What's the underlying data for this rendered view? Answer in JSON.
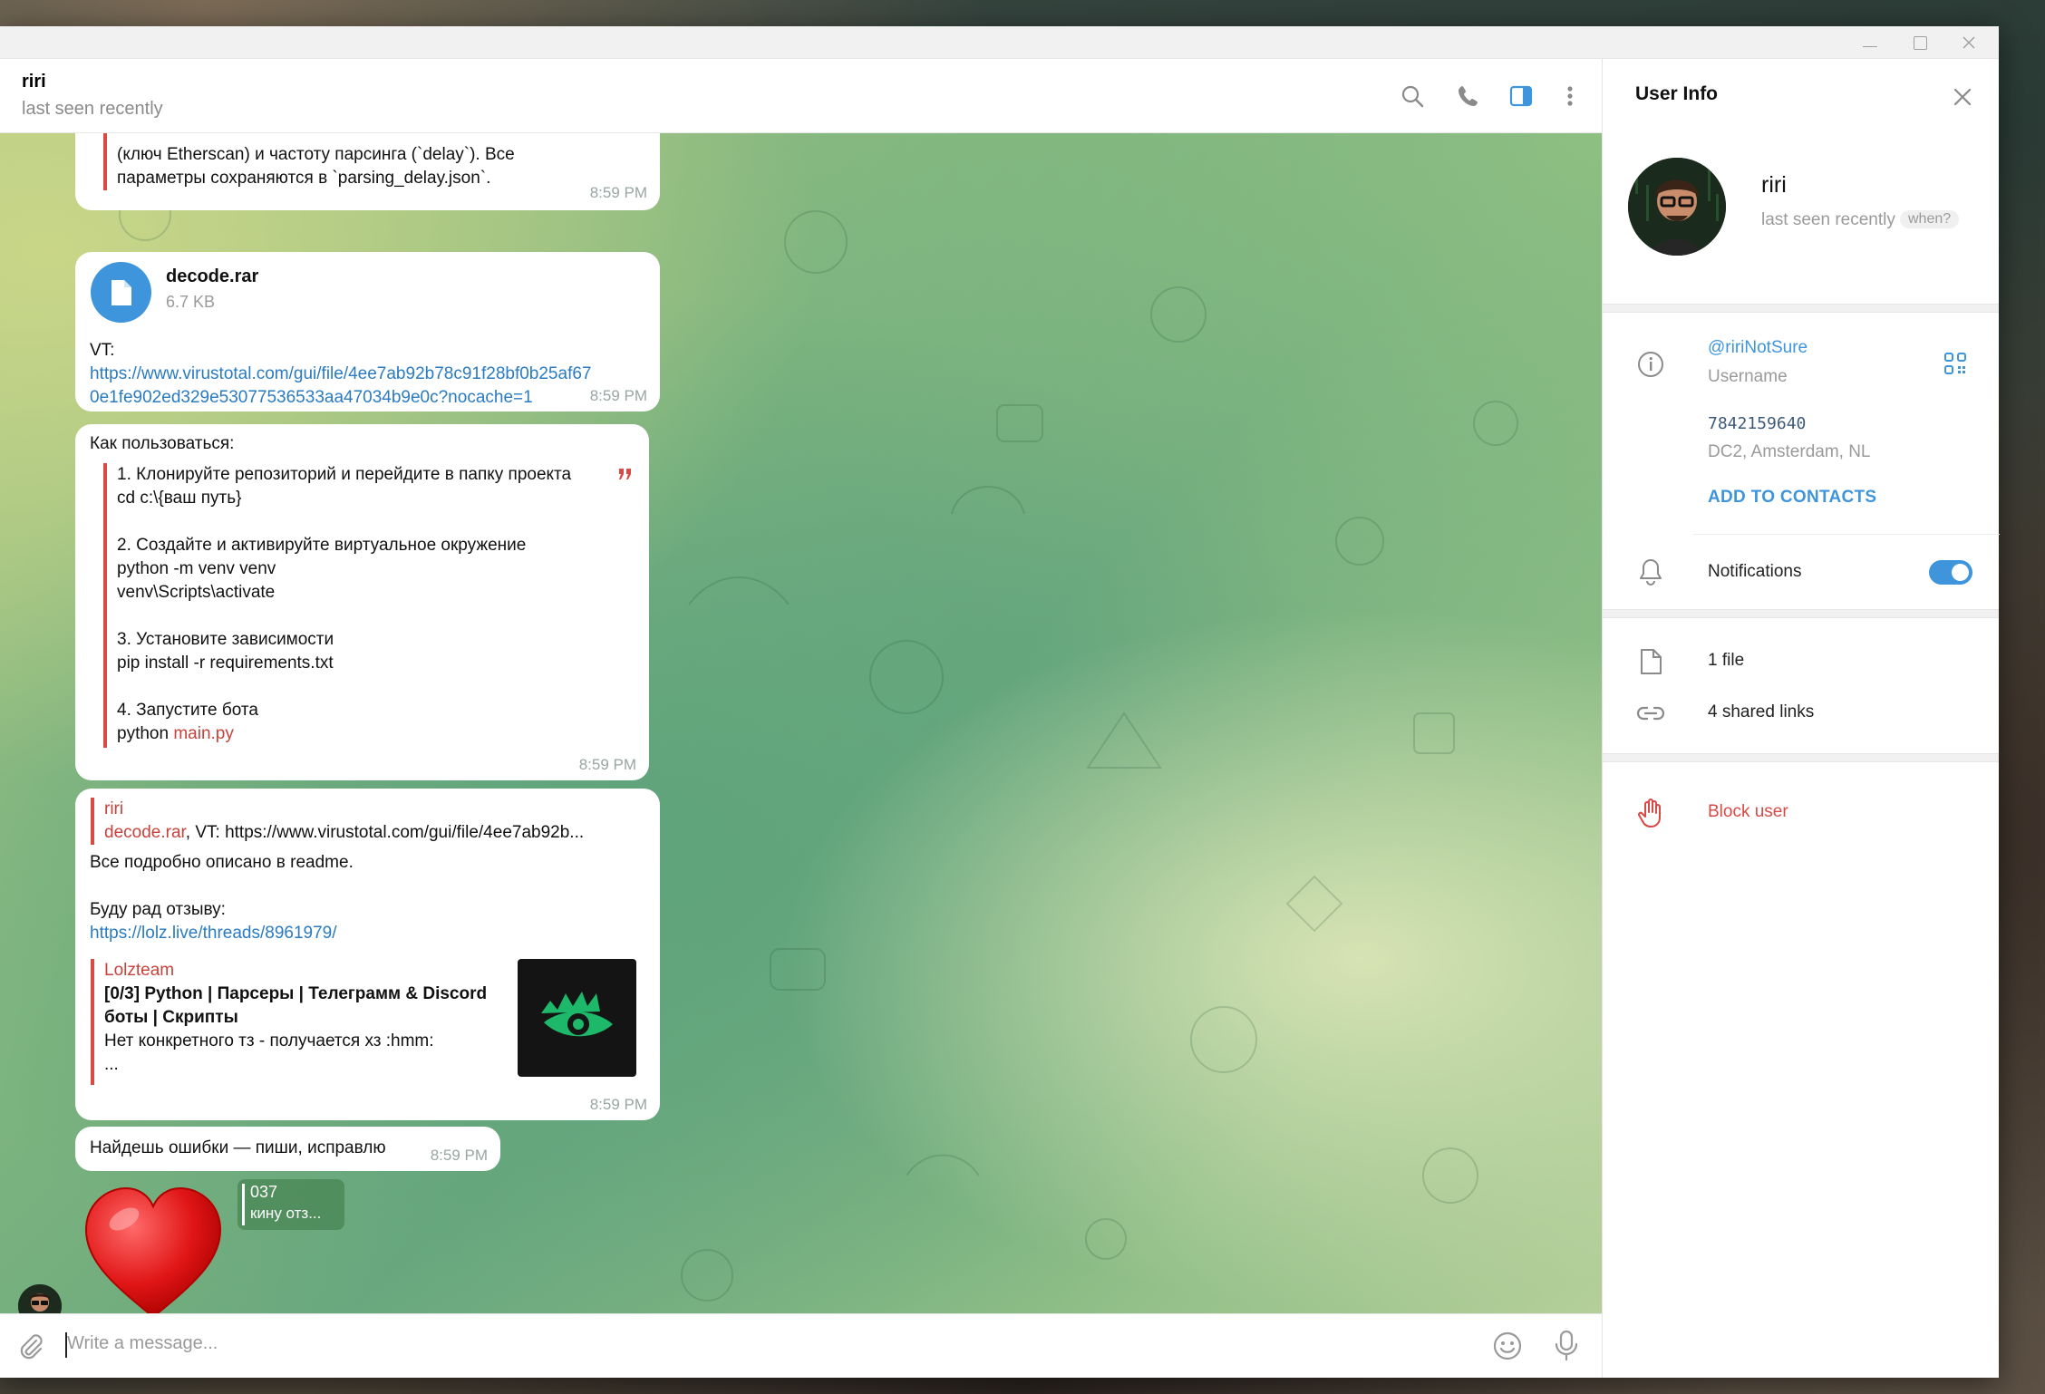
{
  "header": {
    "title": "riri",
    "status": "last seen recently"
  },
  "messages": {
    "m1": {
      "line1": "(ключ Etherscan) и частоту парсинга (`delay`). Все",
      "line2": "параметры сохраняются в `parsing_delay.json`.",
      "time": "8:59 PM"
    },
    "m2": {
      "file_name": "decode.rar",
      "file_size": "6.7 KB",
      "text": "VT:",
      "link1": "https://www.virustotal.com/gui/file/4ee7ab92b78c91f28bf0b25af67",
      "link2": "0e1fe902ed329e53077536533aa47034b9e0c?nocache=1",
      "time": "8:59 PM"
    },
    "m3": {
      "intro": "Как пользоваться:",
      "lines": [
        "1. Клонируйте репозиторий и перейдите в папку проекта",
        "cd c:\\{ваш путь}",
        "",
        "2. Создайте и активируйте виртуальное окружение",
        "python -m venv venv",
        "venv\\Scripts\\activate",
        "",
        "3. Установите зависимости",
        "pip install -r requirements.txt",
        "",
        "4. Запустите бота"
      ],
      "last_prefix": "python ",
      "last_link": "main.py",
      "time": "8:59 PM"
    },
    "m4": {
      "reply_author": "riri",
      "reply_link": "decode.rar",
      "reply_rest": ", VT:  https://www.virustotal.com/gui/file/4ee7ab92b...",
      "text1": "Все подробно описано в readme.",
      "text2": "Буду рад отзыву:",
      "link": "https://lolz.live/threads/8961979/",
      "preview_site": "Lolzteam",
      "preview_title1": "[0/3] Python | Парсеры | Телеграмм & Discord",
      "preview_title2": "боты | Скрипты",
      "preview_desc": "Нет конкретного тз - получается  хз :hmm:",
      "preview_ellipsis": "...",
      "time": "8:59 PM"
    },
    "m5": {
      "text": "Найдешь ошибки — пиши, исправлю",
      "time": "8:59 PM"
    },
    "sticker": {
      "reply_title": "037",
      "reply_text": "кину отз..."
    }
  },
  "input": {
    "placeholder": "Write a message..."
  },
  "info": {
    "title": "User Info",
    "name": "riri",
    "status": "last seen recently",
    "when": "when?",
    "username": "@ririNotSure",
    "username_label": "Username",
    "id": "7842159640",
    "dc": "DC2, Amsterdam, NL",
    "add_contacts": "ADD TO CONTACTS",
    "notifications": "Notifications",
    "files": "1 file",
    "links": "4 shared links",
    "block": "Block user"
  },
  "colors": {
    "accent": "#3e95dc",
    "danger": "#d94a45",
    "link": "#2a7bc1"
  }
}
